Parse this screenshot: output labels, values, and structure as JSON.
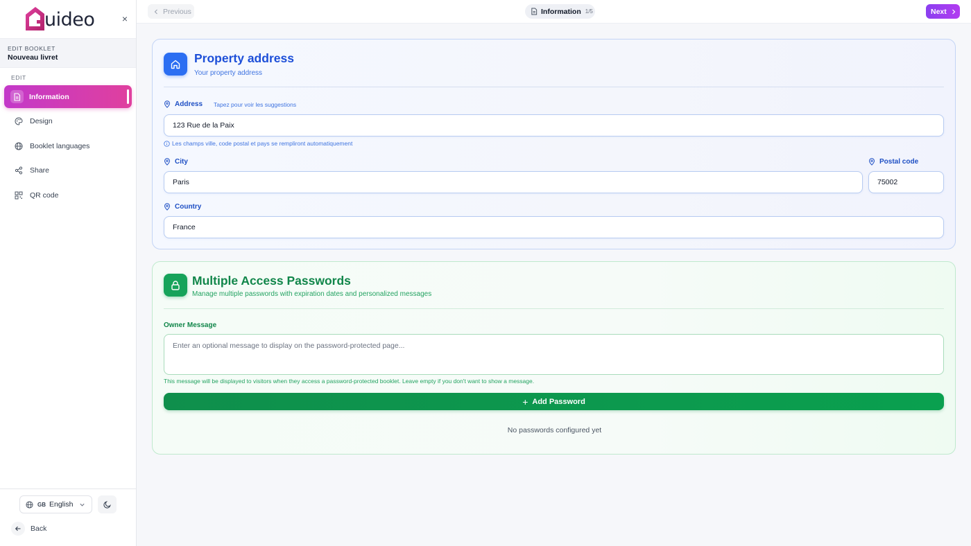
{
  "brand": {
    "logo_text": "uideo",
    "logo_alt": "Guideo",
    "colors": {
      "accent_pink": "#e0409e",
      "accent_purple": "#9b3ff0",
      "blue": "#2b6ef2",
      "green": "#16a35a"
    }
  },
  "sidebar": {
    "close_icon": "×",
    "booklet_kicker": "EDIT BOOKLET",
    "booklet_name": "Nouveau livret",
    "section_label": "EDIT",
    "items": [
      {
        "label": "Information",
        "icon": "document-icon",
        "active": true
      },
      {
        "label": "Design",
        "icon": "palette-icon",
        "active": false
      },
      {
        "label": "Booklet languages",
        "icon": "globe-icon",
        "active": false
      },
      {
        "label": "Share",
        "icon": "share-icon",
        "active": false
      },
      {
        "label": "QR code",
        "icon": "qr-code-icon",
        "active": false
      }
    ],
    "language": {
      "flag": "GB",
      "name": "English"
    },
    "back_label": "Back"
  },
  "topbar": {
    "previous_label": "Previous",
    "step_title": "Information",
    "step_count": "1/5",
    "next_label": "Next"
  },
  "address_card": {
    "title": "Property address",
    "subtitle": "Your property address",
    "address_label": "Address",
    "address_hint": "Tapez pour voir les suggestions",
    "address_value": "123 Rue de la Paix",
    "address_helper": "Les champs ville, code postal et pays se rempliront automatiquement",
    "city_label": "City",
    "city_value": "Paris",
    "postal_label": "Postal code",
    "postal_value": "75002",
    "country_label": "Country",
    "country_value": "France"
  },
  "passwords_card": {
    "title": "Multiple Access Passwords",
    "subtitle": "Manage multiple passwords with expiration dates and personalized messages",
    "owner_label": "Owner Message",
    "owner_placeholder": "Enter an optional message to display on the password-protected page...",
    "owner_helper": "This message will be displayed to visitors when they access a password-protected booklet. Leave empty if you don't want to show a message.",
    "add_button": "Add Password",
    "add_icon": "+",
    "empty_text": "No passwords configured yet"
  }
}
